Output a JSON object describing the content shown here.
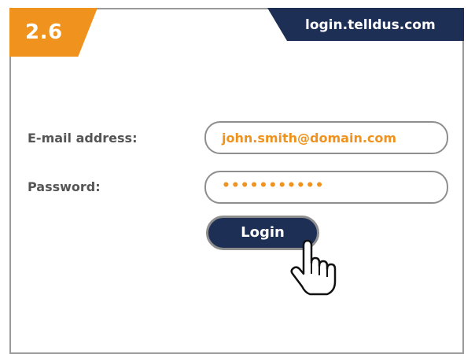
{
  "step": {
    "number": "2.6"
  },
  "header": {
    "url": "login.telldus.com"
  },
  "form": {
    "email_label": "E-mail address:",
    "email_value": "john.smith@domain.com",
    "password_label": "Password:",
    "password_value": "•••••••••••",
    "login_label": "Login"
  },
  "icons": {
    "cursor": "hand-pointer-icon"
  },
  "colors": {
    "accent": "#f0931e",
    "navy": "#1e2f55",
    "border": "#8e8e8e",
    "label": "#555555"
  }
}
